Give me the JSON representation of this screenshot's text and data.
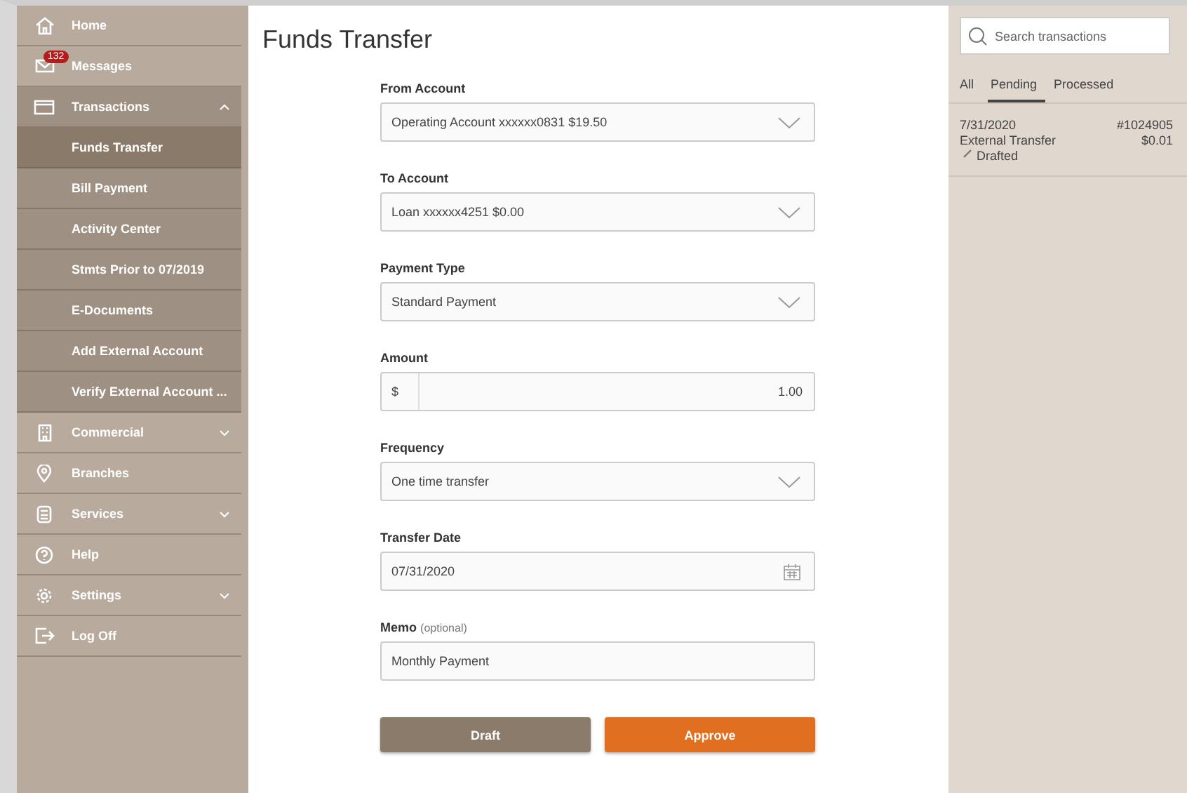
{
  "sidebar": {
    "items": [
      {
        "label": "Home",
        "kind": "link"
      },
      {
        "label": "Messages",
        "kind": "link",
        "badge": "132"
      },
      {
        "label": "Transactions",
        "kind": "group",
        "expanded": true,
        "children": [
          {
            "label": "Funds Transfer",
            "selected": true
          },
          {
            "label": "Bill Payment",
            "selected": false
          },
          {
            "label": "Activity Center",
            "selected": false
          },
          {
            "label": "Stmts Prior to 07/2019",
            "selected": false
          },
          {
            "label": "E-Documents",
            "selected": false
          },
          {
            "label": "Add External Account",
            "selected": false
          },
          {
            "label": "Verify External Account ...",
            "selected": false
          }
        ]
      },
      {
        "label": "Commercial",
        "kind": "group",
        "expanded": false
      },
      {
        "label": "Branches",
        "kind": "link"
      },
      {
        "label": "Services",
        "kind": "group",
        "expanded": false
      },
      {
        "label": "Help",
        "kind": "link"
      },
      {
        "label": "Settings",
        "kind": "group",
        "expanded": false
      },
      {
        "label": "Log Off",
        "kind": "link"
      }
    ]
  },
  "page": {
    "title": "Funds Transfer"
  },
  "form": {
    "fields": [
      {
        "label": "From Account",
        "kind": "select",
        "value": "Operating Account xxxxxx0831 $19.50"
      },
      {
        "label": "To Account",
        "kind": "select",
        "value": "Loan xxxxxx4251 $0.00"
      },
      {
        "label": "Payment Type",
        "kind": "select",
        "value": "Standard Payment"
      },
      {
        "label": "Amount",
        "kind": "amount",
        "prefix": "$",
        "value": "1.00"
      },
      {
        "label": "Frequency",
        "kind": "select",
        "value": "One time transfer"
      },
      {
        "label": "Transfer Date",
        "kind": "date",
        "value": "07/31/2020"
      },
      {
        "label": "Memo",
        "hint": "(optional)",
        "kind": "text",
        "value": "Monthly Payment"
      }
    ],
    "buttons": [
      {
        "label": "Draft",
        "kind": "secondary"
      },
      {
        "label": "Approve",
        "kind": "primary"
      }
    ]
  },
  "transactions": {
    "search": {
      "placeholder": "Search transactions"
    },
    "tabs": [
      {
        "label": "All",
        "selected": false
      },
      {
        "label": "Pending",
        "selected": true
      },
      {
        "label": "Processed",
        "selected": false
      }
    ],
    "items": [
      {
        "date": "7/31/2020",
        "number": "#1024905",
        "description": "External Transfer",
        "amount": "$0.01",
        "status": "Drafted"
      }
    ]
  }
}
